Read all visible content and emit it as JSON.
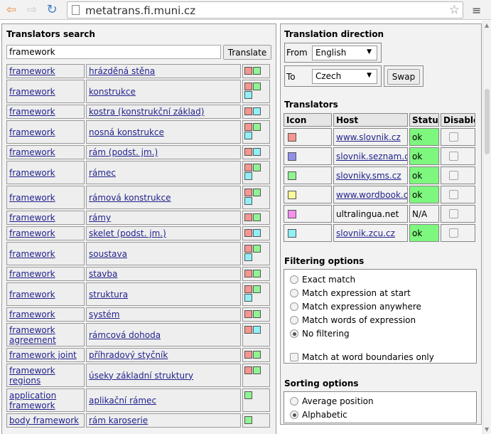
{
  "browser": {
    "url": "metatrans.fi.muni.cz",
    "back_glyph": "⇦",
    "forward_glyph": "⇨",
    "reload_glyph": "↻",
    "star_glyph": "☆",
    "menu_glyph": "≡"
  },
  "search": {
    "title": "Translators search",
    "query": "framework",
    "button": "Translate"
  },
  "colors": {
    "red": "#f59690",
    "green": "#90f490",
    "cyan": "#90f0f6",
    "blue": "#9090ea",
    "yellow": "#fbfb9a",
    "pink": "#f690ef",
    "status_ok": "#7df77d"
  },
  "results": [
    {
      "src": "framework",
      "dst": "hrázděná stěna",
      "icons": [
        "red",
        "green"
      ]
    },
    {
      "src": "framework",
      "dst": "konstrukce",
      "icons": [
        "red",
        "green",
        "cyan"
      ]
    },
    {
      "src": "framework",
      "dst": "kostra (konstrukční základ)",
      "icons": [
        "red",
        "cyan"
      ]
    },
    {
      "src": "framework",
      "dst": "nosná konstrukce",
      "icons": [
        "red",
        "green",
        "cyan"
      ]
    },
    {
      "src": "framework",
      "dst": "rám (podst. jm.)",
      "icons": [
        "red",
        "cyan"
      ]
    },
    {
      "src": "framework",
      "dst": "rámec",
      "icons": [
        "red",
        "green",
        "cyan"
      ]
    },
    {
      "src": "framework",
      "dst": "rámová konstrukce",
      "icons": [
        "red",
        "green",
        "cyan"
      ]
    },
    {
      "src": "framework",
      "dst": "rámy",
      "icons": [
        "red",
        "green"
      ]
    },
    {
      "src": "framework",
      "dst": "skelet (podst. jm.)",
      "icons": [
        "red",
        "cyan"
      ]
    },
    {
      "src": "framework",
      "dst": "soustava",
      "icons": [
        "red",
        "green",
        "cyan"
      ]
    },
    {
      "src": "framework",
      "dst": "stavba",
      "icons": [
        "red",
        "green"
      ]
    },
    {
      "src": "framework",
      "dst": "struktura",
      "icons": [
        "red",
        "green",
        "cyan"
      ]
    },
    {
      "src": "framework",
      "dst": "systém",
      "icons": [
        "red",
        "green"
      ]
    },
    {
      "src": "framework agreement",
      "dst": "rámcová dohoda",
      "icons": [
        "red",
        "cyan"
      ]
    },
    {
      "src": "framework joint",
      "dst": "příhradový styčník",
      "icons": [
        "red",
        "green"
      ]
    },
    {
      "src": "framework regions",
      "dst": "úseky základní struktury",
      "icons": [
        "red",
        "green"
      ]
    },
    {
      "src": "application framework",
      "dst": "aplikační rámec",
      "icons": [
        "green"
      ]
    },
    {
      "src": "body framework",
      "dst": "rám karoserie",
      "icons": [
        "green"
      ]
    }
  ],
  "direction": {
    "title": "Translation direction",
    "from_label": "From",
    "from_value": "English",
    "to_label": "To",
    "to_value": "Czech",
    "swap": "Swap",
    "arrow": "▼"
  },
  "translators": {
    "title": "Translators",
    "headers": [
      "Icon",
      "Host",
      "Status",
      "Disable"
    ],
    "rows": [
      {
        "color": "red",
        "host": "www.slovnik.cz",
        "status": "ok",
        "ok": true
      },
      {
        "color": "blue",
        "host": "slovnik.seznam.cz",
        "status": "ok",
        "ok": true
      },
      {
        "color": "green",
        "host": "slovniky.sms.cz",
        "status": "ok",
        "ok": true
      },
      {
        "color": "yellow",
        "host": "www.wordbook.cz",
        "status": "ok",
        "ok": true
      },
      {
        "color": "pink",
        "host": "ultralingua.net",
        "status": "N/A",
        "ok": false
      },
      {
        "color": "cyan",
        "host": "slovnik.zcu.cz",
        "status": "ok",
        "ok": true
      }
    ]
  },
  "filtering": {
    "title": "Filtering options",
    "options": [
      "Exact match",
      "Match expression at start",
      "Match expression anywhere",
      "Match words of expression",
      "No filtering"
    ],
    "selected": 4,
    "word_boundaries": "Match at word boundaries only"
  },
  "sorting": {
    "title": "Sorting options",
    "options": [
      "Average position",
      "Alphabetic"
    ],
    "selected": 1
  }
}
